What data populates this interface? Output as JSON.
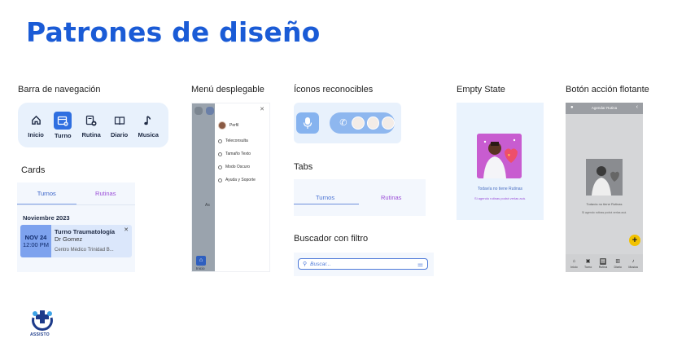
{
  "title": "Patrones de diseño",
  "sections": {
    "navbar": "Barra de navegación",
    "cards": "Cards",
    "dropdown": "Menú desplegable",
    "icons": "Íconos reconocibles",
    "tabs": "Tabs",
    "search": "Buscador con filtro",
    "empty": "Empty State",
    "fab": "Botón acción flotante"
  },
  "navbar": {
    "items": [
      {
        "label": "Inicio",
        "icon": "home-icon"
      },
      {
        "label": "Turno",
        "icon": "calendar-add-icon",
        "active": true
      },
      {
        "label": "Rutina",
        "icon": "routine-add-icon"
      },
      {
        "label": "Diario",
        "icon": "book-icon"
      },
      {
        "label": "Musica",
        "icon": "music-note-icon"
      }
    ]
  },
  "cards": {
    "tab1": "Turnos",
    "tab2": "Rutinas",
    "month": "Noviembre 2023",
    "date": "NOV 24",
    "time": "12:00 PM",
    "appt_title": "Turno Traumatología",
    "doctor": "Dr Gomez",
    "location": "Centro Médico Trinidad B..."
  },
  "dropdown": {
    "left_text": "As",
    "home_label": "Inicio",
    "items": [
      "Perfil",
      "Teleconsulta",
      "Tamaño Texto",
      "Modo Oscuro",
      "Ayuda y Soporte"
    ]
  },
  "tabs": {
    "tab1": "Turnos",
    "tab2": "Rutinas"
  },
  "search": {
    "placeholder": "Buscar..."
  },
  "empty": {
    "line1": "Todavía no tiene Rutinas",
    "line2": "Si agendo rutinas podrá verlas acá."
  },
  "fab": {
    "header": "Agendar Rutina",
    "line1": "Todavía no tiene Rutinas",
    "line2": "Si agendo rutinas podrá verlas acá.",
    "nav": [
      "Inicio",
      "Turno",
      "Rutina",
      "Diario",
      "Musica"
    ]
  },
  "logo": {
    "word": "ASSISTO"
  },
  "colors": {
    "brand": "#1a5bd6",
    "accent_purple": "#9b4fd8",
    "fab_yellow": "#f2c200"
  }
}
